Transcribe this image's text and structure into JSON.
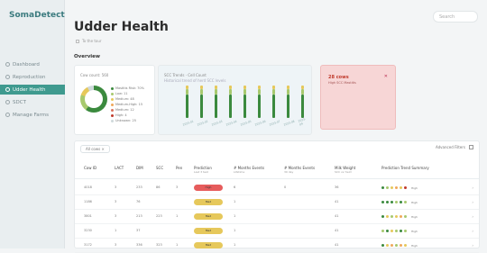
{
  "app": {
    "logo": "SomaDetect",
    "search_placeholder": "Search"
  },
  "sidebar": {
    "items": [
      {
        "label": "Dashboard",
        "active": false,
        "icon": "dashboard-icon"
      },
      {
        "label": "Reproduction",
        "active": false,
        "icon": "reproduction-icon"
      },
      {
        "label": "Udder Health",
        "active": true,
        "icon": "udder-icon"
      },
      {
        "label": "SDCT",
        "active": false,
        "icon": "sdct-icon"
      },
      {
        "label": "Manage Farms",
        "active": false,
        "icon": "farm-icon"
      }
    ]
  },
  "page": {
    "title": "Udder Health",
    "subtitle": "To the tour",
    "overview_label": "Overview"
  },
  "cards": {
    "donut": {
      "label": "Cow count: 560",
      "legend": [
        {
          "label": "Mastitis Risk: 70%",
          "color": "#3b8a3e"
        },
        {
          "label": "Low: 11",
          "color": "#a7c96e"
        },
        {
          "label": "Medium: 48",
          "color": "#e6c85b"
        },
        {
          "label": "Medium-High: 15",
          "color": "#f0a85b"
        },
        {
          "label": "Medium: 12",
          "color": "#d9735e"
        },
        {
          "label": "High: 4",
          "color": "#c0392b"
        },
        {
          "label": "Unknown: 25",
          "color": "#cfd9db"
        }
      ]
    },
    "trend": {
      "label": "SCC Trends · Cell Count",
      "sublabel": "Historical trend of herd SCC levels",
      "categories": [
        "2023-01",
        "2023-02",
        "2023-03",
        "2023-04",
        "2023-05",
        "2023-06",
        "2023-07",
        "2023-08",
        "2023-09"
      ]
    },
    "alert": {
      "title": "28 cows",
      "subtitle": "High SCC Mastitis"
    }
  },
  "table": {
    "filter_chip": "All cows",
    "filter_tool": "Advanced Filters",
    "columns": [
      {
        "label": "Cow ID",
        "sub": ""
      },
      {
        "label": "LACT",
        "sub": ""
      },
      {
        "label": "DIM",
        "sub": ""
      },
      {
        "label": "SCC",
        "sub": ""
      },
      {
        "label": "Pen",
        "sub": ""
      },
      {
        "label": "Prediction",
        "sub": "Last 3 test"
      },
      {
        "label": "# Months Events",
        "sub": "Lifetime"
      },
      {
        "label": "# Months Events",
        "sub": "30 day"
      },
      {
        "label": "Milk Weight",
        "sub": "SCC vs Yield"
      },
      {
        "label": "Prediction Trend Summary",
        "sub": ""
      }
    ],
    "rows": [
      {
        "cells": [
          "4018",
          "3",
          "233",
          "86",
          "3"
        ],
        "prediction": "High",
        "pred_color": "#e65c5c",
        "m1": "6",
        "m2": "0",
        "milk": "36",
        "trend": [
          "#3b8a3e",
          "#a7c96e",
          "#e6c85b",
          "#f0a85b",
          "#e6c85b",
          "#c0392b"
        ],
        "trend_label": "High"
      },
      {
        "cells": [
          "1186",
          "3",
          "76",
          "",
          ""
        ],
        "prediction": "Med",
        "pred_color": "#e6c85b",
        "m1": "1",
        "m2": "",
        "milk": "41",
        "trend": [
          "#3b8a3e",
          "#3b8a3e",
          "#3b8a3e",
          "#a7c96e",
          "#3b8a3e",
          "#a7c96e"
        ],
        "trend_label": "High"
      },
      {
        "cells": [
          "3801",
          "3",
          "213",
          "223",
          "1"
        ],
        "prediction": "Med",
        "pred_color": "#e6c85b",
        "m1": "1",
        "m2": "",
        "milk": "41",
        "trend": [
          "#3b8a3e",
          "#e6c85b",
          "#a7c96e",
          "#e6c85b",
          "#f0a85b",
          "#a7c96e"
        ],
        "trend_label": "High"
      },
      {
        "cells": [
          "3230",
          "1",
          "37",
          "",
          ""
        ],
        "prediction": "Med",
        "pred_color": "#e6c85b",
        "m1": "1",
        "m2": "",
        "milk": "41",
        "trend": [
          "#a7c96e",
          "#3b8a3e",
          "#e6c85b",
          "#a7c96e",
          "#3b8a3e",
          "#a7c96e"
        ],
        "trend_label": "High"
      },
      {
        "cells": [
          "3172",
          "3",
          "336",
          "323",
          "1"
        ],
        "prediction": "Med",
        "pred_color": "#e6c85b",
        "m1": "1",
        "m2": "",
        "milk": "41",
        "trend": [
          "#3b8a3e",
          "#e6c85b",
          "#f0a85b",
          "#a7c96e",
          "#f0a85b",
          "#e6c85b"
        ],
        "trend_label": "High"
      }
    ]
  }
}
